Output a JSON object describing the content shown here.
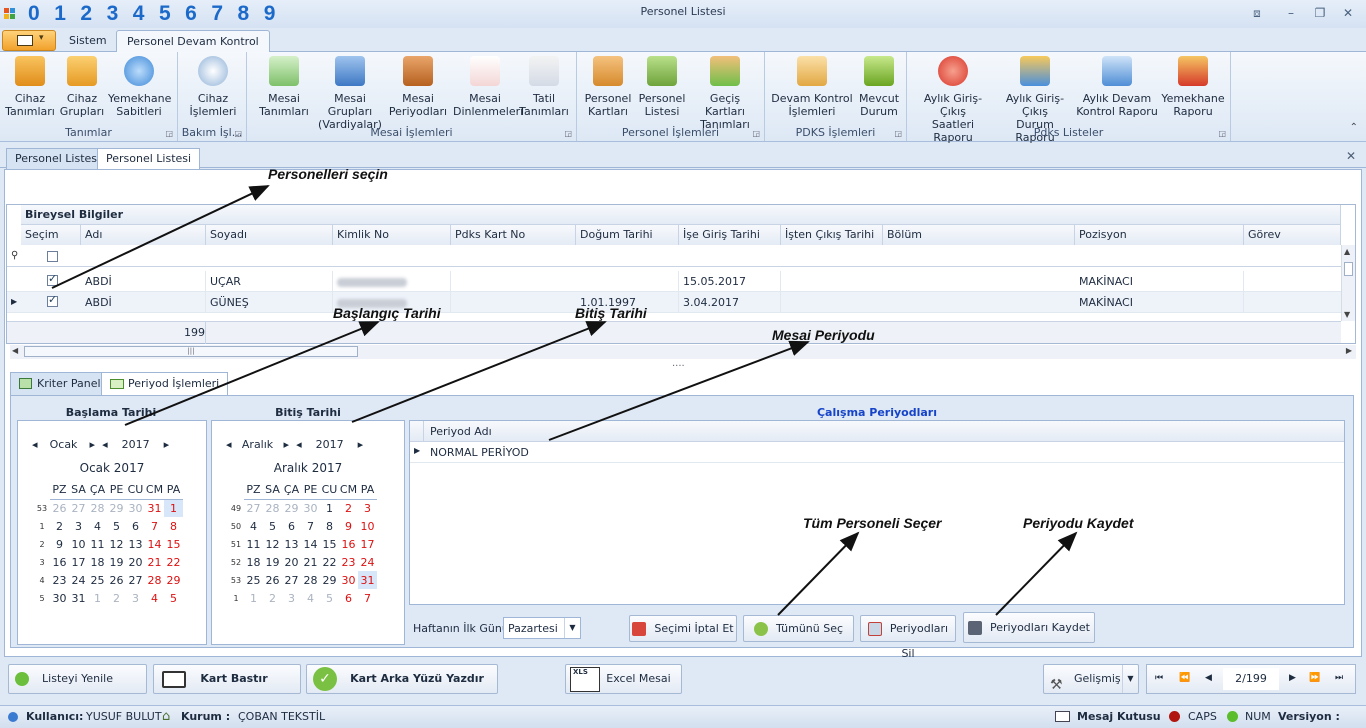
{
  "titlebar": {
    "digits": [
      "0",
      "1",
      "2",
      "3",
      "4",
      "5",
      "6",
      "7",
      "8",
      "9"
    ],
    "title": "Personel Listesi"
  },
  "ribbon_tabs": [
    "Sistem",
    "Personel Devam Kontrol"
  ],
  "ribbon": {
    "groups": [
      {
        "caption": "Tanımlar",
        "buttons": [
          {
            "line1": "Cihaz",
            "line2": "Tanımları",
            "icon": "folder-icon"
          },
          {
            "line1": "Cihaz",
            "line2": "Grupları",
            "icon": "folders-icon"
          },
          {
            "line1": "Yemekhane",
            "line2": "Sabitleri",
            "icon": "plus-circle-icon"
          }
        ]
      },
      {
        "caption": "Bakım İşl...",
        "buttons": [
          {
            "line1": "Cihaz",
            "line2": "İşlemleri",
            "icon": "gauge-icon"
          }
        ]
      },
      {
        "caption": "Mesai İşlemleri",
        "buttons": [
          {
            "line1": "Mesai",
            "line2": "Tanımları",
            "icon": "arrow-box-icon"
          },
          {
            "line1": "Mesai Grupları",
            "line2": "(Vardiyalar)",
            "icon": "hierarchy-icon"
          },
          {
            "line1": "Mesai",
            "line2": "Periyodları",
            "icon": "briefcase-icon"
          },
          {
            "line1": "Mesai",
            "line2": "Dinlenmeleri",
            "icon": "chart-line-icon"
          },
          {
            "line1": "Tatil",
            "line2": "Tanımları",
            "icon": "calendar-icon"
          }
        ]
      },
      {
        "caption": "Personel İşlemleri",
        "buttons": [
          {
            "line1": "Personel",
            "line2": "Kartları",
            "icon": "person-icon"
          },
          {
            "line1": "Personel",
            "line2": "Listesi",
            "icon": "people-icon"
          },
          {
            "line1": "Geçiş Kartları",
            "line2": "Tanımları",
            "icon": "person-arrow-icon"
          }
        ]
      },
      {
        "caption": "PDKS İşlemleri",
        "buttons": [
          {
            "line1": "Devam Kontrol",
            "line2": "İşlemleri",
            "icon": "clipboard-check-icon"
          },
          {
            "line1": "Mevcut",
            "line2": "Durum",
            "icon": "flag-icon"
          }
        ]
      },
      {
        "caption": "Pdks Listeler",
        "buttons": [
          {
            "line1": "Aylık Giriş-Çıkış",
            "line2": "Saatleri Raporu",
            "icon": "pie-chart-icon"
          },
          {
            "line1": "Aylık Giriş-Çıkış",
            "line2": "Durum Raporu",
            "icon": "bar-chart-icon"
          },
          {
            "line1": "Aylık Devam",
            "line2": "Kontrol Raporu",
            "icon": "area-chart-icon"
          },
          {
            "line1": "Yemekhane",
            "line2": "Raporu",
            "icon": "sigma-chart-icon"
          }
        ]
      }
    ]
  },
  "doc_tabs": [
    "Personel Listesi",
    "Personel Listesi"
  ],
  "grid": {
    "band": "Bireysel Bilgiler",
    "columns": [
      "Seçim",
      "Adı",
      "Soyadı",
      "Kimlik No",
      "Pdks Kart No",
      "Doğum Tarihi",
      "İşe Giriş Tarihi",
      "İşten Çıkış Tarihi",
      "Bölüm",
      "Pozisyon",
      "Görev"
    ],
    "rows": [
      {
        "selected": true,
        "ad": "ABDİ",
        "soyad": "UÇAR",
        "dogum": "",
        "giris": "15.05.2017",
        "pozisyon": "MAKİNACI"
      },
      {
        "selected": true,
        "ad": "ABDİ",
        "soyad": "GÜNEŞ",
        "dogum": "1.01.1997",
        "giris": "3.04.2017",
        "pozisyon": "MAKİNACI"
      }
    ],
    "count": "199"
  },
  "lower_tabs": [
    "Kriter Paneli",
    "Periyod İşlemleri"
  ],
  "start_cal": {
    "section": "Başlama Tarihi",
    "month": "Ocak",
    "year": "2017",
    "header": "Ocak 2017",
    "weekdays": [
      "PZ",
      "SA",
      "ÇA",
      "PE",
      "CU",
      "CM",
      "PA"
    ],
    "weeks": [
      {
        "wk": "53",
        "days": [
          "26",
          "27",
          "28",
          "29",
          "30",
          "31",
          "1"
        ]
      },
      {
        "wk": "1",
        "days": [
          "2",
          "3",
          "4",
          "5",
          "6",
          "7",
          "8"
        ]
      },
      {
        "wk": "2",
        "days": [
          "9",
          "10",
          "11",
          "12",
          "13",
          "14",
          "15"
        ]
      },
      {
        "wk": "3",
        "days": [
          "16",
          "17",
          "18",
          "19",
          "20",
          "21",
          "22"
        ]
      },
      {
        "wk": "4",
        "days": [
          "23",
          "24",
          "25",
          "26",
          "27",
          "28",
          "29"
        ]
      },
      {
        "wk": "5",
        "days": [
          "30",
          "31",
          "1",
          "2",
          "3",
          "4",
          "5"
        ]
      }
    ],
    "selected_day": "1"
  },
  "end_cal": {
    "section": "Bitiş Tarihi",
    "month": "Aralık",
    "year": "2017",
    "header": "Aralık 2017",
    "weekdays": [
      "PZ",
      "SA",
      "ÇA",
      "PE",
      "CU",
      "CM",
      "PA"
    ],
    "weeks": [
      {
        "wk": "49",
        "days": [
          "27",
          "28",
          "29",
          "30",
          "1",
          "2",
          "3"
        ]
      },
      {
        "wk": "50",
        "days": [
          "4",
          "5",
          "6",
          "7",
          "8",
          "9",
          "10"
        ]
      },
      {
        "wk": "51",
        "days": [
          "11",
          "12",
          "13",
          "14",
          "15",
          "16",
          "17"
        ]
      },
      {
        "wk": "52",
        "days": [
          "18",
          "19",
          "20",
          "21",
          "22",
          "23",
          "24"
        ]
      },
      {
        "wk": "53",
        "days": [
          "25",
          "26",
          "27",
          "28",
          "29",
          "30",
          "31"
        ]
      },
      {
        "wk": "1",
        "days": [
          "1",
          "2",
          "3",
          "4",
          "5",
          "6",
          "7"
        ]
      }
    ],
    "selected_day": "31"
  },
  "periods": {
    "title": "Çalışma Periyodları",
    "column": "Periyod Adı",
    "rows": [
      "NORMAL PERİYOD"
    ],
    "first_day_label": "Haftanın İlk Günü:",
    "first_day_value": "Pazartesi",
    "buttons": [
      "Seçimi İptal Et",
      "Tümünü Seç",
      "Periyodları Sil",
      "Periyodları Kaydet"
    ]
  },
  "bottom_buttons": [
    "Listeyi Yenile",
    "Kart Bastır",
    "Kart Arka Yüzü Yazdır",
    "Excel Mesai",
    "Gelişmiş"
  ],
  "pager": {
    "value": "2/199"
  },
  "status": {
    "user_label": "Kullanıcı:",
    "user": "YUSUF BULUT",
    "company_label": "Kurum :",
    "company": "ÇOBAN TEKSTİL",
    "messages": "Mesaj Kutusu",
    "caps": "CAPS",
    "num": "NUM",
    "version_label": "Versiyon :"
  },
  "annotations": [
    "Personelleri seçin",
    "Başlangıç Tarihi",
    "Bitiş Tarihi",
    "Mesai Periyodu",
    "Tüm Personeli Seçer",
    "Periyodu Kaydet"
  ],
  "colors": {
    "accent": "#1b69c9",
    "period_title": "#1544c9",
    "weekend": "#dd1111"
  }
}
